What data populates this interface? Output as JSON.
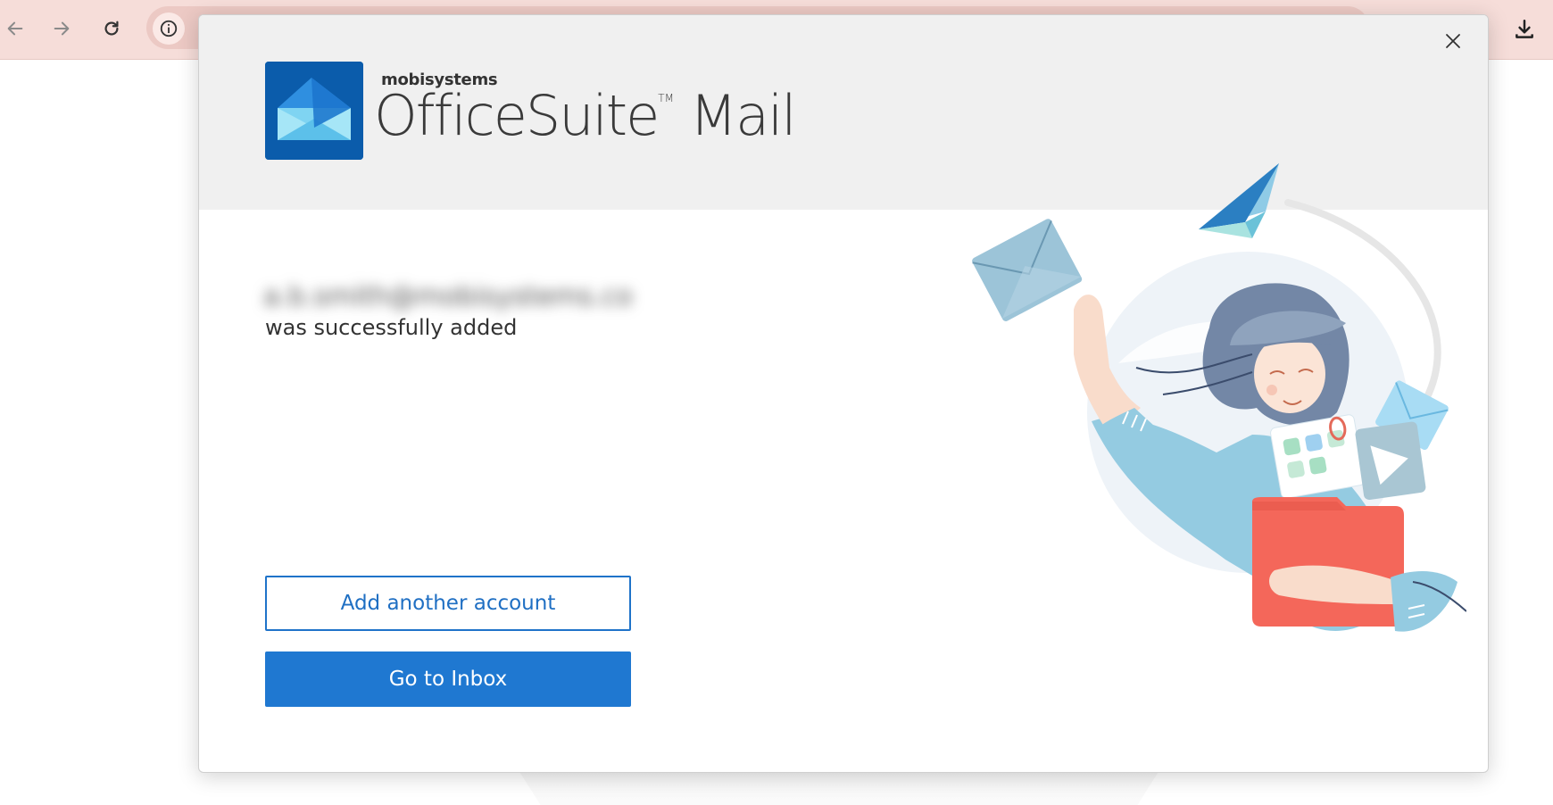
{
  "browser": {
    "back_icon": "arrow-left-icon",
    "forward_icon": "arrow-right-icon",
    "reload_icon": "reload-icon",
    "site_info_icon": "info-icon",
    "download_icon": "download-icon"
  },
  "dialog": {
    "close_icon": "close-icon",
    "brand": {
      "vendor": "mobisystems",
      "product": "OfficeSuite",
      "trademark": "TM",
      "suffix": " Mail"
    },
    "account": {
      "email": "a.b.smith@mobisystems.co",
      "status_text": "was successfully added"
    },
    "buttons": {
      "add_account": "Add another account",
      "go_inbox": "Go to Inbox"
    }
  },
  "colors": {
    "toolbar_bg": "#f6ddd9",
    "header_bg": "#f0f0f0",
    "primary": "#1f78d1",
    "logo_blue": "#0b5cab",
    "folder_red": "#f4675a"
  }
}
